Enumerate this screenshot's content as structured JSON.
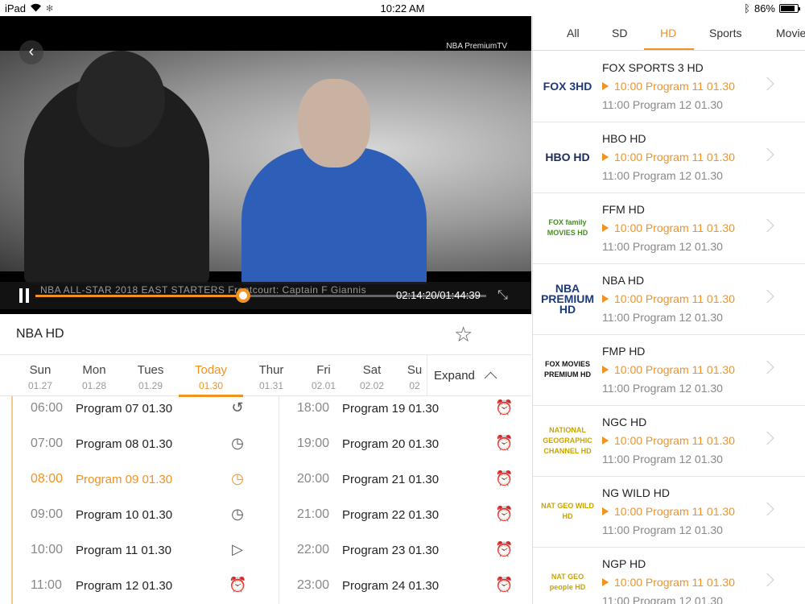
{
  "status_bar": {
    "device": "iPad",
    "time": "10:22 AM",
    "battery": "86%"
  },
  "player": {
    "channel_logo_text": "NBA PremiumTV",
    "ticker": "NBA ALL-STAR 2018    EAST STARTERS    Frontcourt: Captain    F Giannis",
    "timecode": "02:14:20/01:44:39",
    "progress": 0.46
  },
  "info": {
    "channel_title": "NBA HD"
  },
  "days": [
    {
      "name": "Sun",
      "date": "01.27",
      "active": false
    },
    {
      "name": "Mon",
      "date": "01.28",
      "active": false
    },
    {
      "name": "Tues",
      "date": "01.29",
      "active": false
    },
    {
      "name": "Today",
      "date": "01.30",
      "active": true
    },
    {
      "name": "Thur",
      "date": "01.31",
      "active": false
    },
    {
      "name": "Fri",
      "date": "02.01",
      "active": false
    },
    {
      "name": "Sat",
      "date": "02.02",
      "active": false
    },
    {
      "name": "Su",
      "date": "02",
      "active": false
    }
  ],
  "expand_label": "Expand",
  "schedule_left": [
    {
      "time": "06:00",
      "program": "Program 07 01.30",
      "icon": "replay-icon",
      "current": false
    },
    {
      "time": "07:00",
      "program": "Program 08 01.30",
      "icon": "history-icon",
      "current": false
    },
    {
      "time": "08:00",
      "program": "Program 09 01.30",
      "icon": "history-icon",
      "current": true
    },
    {
      "time": "09:00",
      "program": "Program 10 01.30",
      "icon": "history-icon",
      "current": false
    },
    {
      "time": "10:00",
      "program": "Program 11 01.30",
      "icon": "play-icon",
      "current": false
    },
    {
      "time": "11:00",
      "program": "Program 12 01.30",
      "icon": "alarm-icon",
      "current": false
    }
  ],
  "schedule_right": [
    {
      "time": "18:00",
      "program": "Program 19 01.30",
      "icon": "alarm-icon"
    },
    {
      "time": "19:00",
      "program": "Program 20 01.30",
      "icon": "alarm-icon"
    },
    {
      "time": "20:00",
      "program": "Program 21 01.30",
      "icon": "alarm-icon"
    },
    {
      "time": "21:00",
      "program": "Program 22 01.30",
      "icon": "alarm-icon"
    },
    {
      "time": "22:00",
      "program": "Program 23 01.30",
      "icon": "alarm-icon"
    },
    {
      "time": "23:00",
      "program": "Program 24 01.30",
      "icon": "alarm-icon"
    }
  ],
  "tabs": [
    {
      "label": "All",
      "active": false
    },
    {
      "label": "SD",
      "active": false
    },
    {
      "label": "HD",
      "active": true
    },
    {
      "label": "Sports",
      "active": false
    },
    {
      "label": "Movie",
      "active": false
    }
  ],
  "channels": [
    {
      "name": "FOX SPORTS 3 HD",
      "logo": "FOX 3HD",
      "now": "10:00  Program 11 01.30",
      "next": "11:00  Program 12 01.30"
    },
    {
      "name": "HBO HD",
      "logo": "HBO HD",
      "now": "10:00  Program 11 01.30",
      "next": "11:00  Program 12 01.30"
    },
    {
      "name": "FFM HD",
      "logo": "FOX family MOVIES HD",
      "now": "10:00  Program 11 01.30",
      "next": "11:00  Program 12 01.30"
    },
    {
      "name": "NBA HD",
      "logo": "NBA PREMIUM HD",
      "now": "10:00  Program 11 01.30",
      "next": "11:00  Program 12 01.30"
    },
    {
      "name": "FMP HD",
      "logo": "FOX MOVIES PREMIUM HD",
      "now": "10:00  Program 11 01.30",
      "next": "11:00  Program 12 01.30"
    },
    {
      "name": "NGC HD",
      "logo": "NATIONAL GEOGRAPHIC CHANNEL HD",
      "now": "10:00  Program 11 01.30",
      "next": "11:00  Program 12 01.30"
    },
    {
      "name": "NG WILD HD",
      "logo": "NAT GEO WILD HD",
      "now": "10:00  Program 11 01.30",
      "next": "11:00  Program 12 01.30"
    },
    {
      "name": "NGP HD",
      "logo": "NAT GEO people HD",
      "now": "10:00  Program 11 01.30",
      "next": "11:00  Program 12 01.30"
    }
  ]
}
